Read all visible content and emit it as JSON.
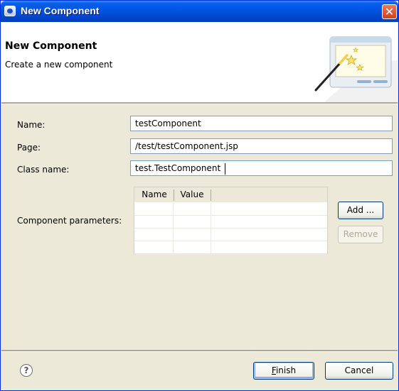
{
  "window": {
    "title": "New Component",
    "close_glyph": "✕"
  },
  "banner": {
    "title": "New Component",
    "description": "Create a new component",
    "image_icon": "wizard-wand-icon"
  },
  "form": {
    "name_label": "Name:",
    "name_value": "testComponent",
    "page_label": "Page:",
    "page_value": "/test/testComponent.jsp",
    "class_label": "Class name:",
    "class_value": "test.TestComponent",
    "params_label": "Component parameters:"
  },
  "params_table": {
    "columns": [
      "Name",
      "Value"
    ],
    "rows": []
  },
  "params_buttons": {
    "add_label": "Add ...",
    "remove_label": "Remove"
  },
  "footer": {
    "help_glyph": "?",
    "finish_mnemonic": "F",
    "finish_rest": "inish",
    "cancel_label": "Cancel"
  },
  "colors": {
    "titlebar": "#0054e3",
    "dialog_bg": "#ece9d8",
    "field_border": "#7f9db9",
    "close_button": "#d0411f"
  }
}
